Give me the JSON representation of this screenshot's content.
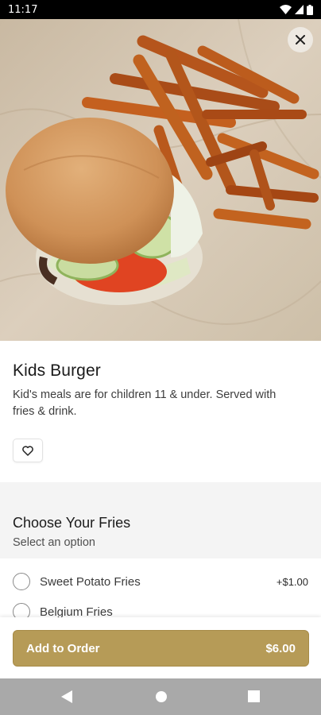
{
  "status_bar": {
    "time": "11:17",
    "icons": [
      "wifi-icon",
      "cell-signal-icon",
      "battery-icon"
    ]
  },
  "hero": {
    "image": "burger-with-sweet-potato-fries-photo",
    "close_icon": "close-icon"
  },
  "item": {
    "title": "Kids Burger",
    "description": "Kid's meals are for children 11 & under. Served with fries & drink.",
    "favorite_icon": "heart-outline-icon"
  },
  "option_group": {
    "title": "Choose Your Fries",
    "subtitle": "Select an option",
    "options": [
      {
        "label": "Sweet Potato Fries",
        "price": "+$1.00",
        "selected": false
      },
      {
        "label": "Belgium Fries",
        "price": "",
        "selected": false
      }
    ]
  },
  "footer": {
    "add_label": "Add to Order",
    "total": "$6.00"
  },
  "nav_bar": {
    "icons": [
      "back-triangle-icon",
      "home-circle-icon",
      "recents-square-icon"
    ]
  },
  "colors": {
    "accent": "#b69b57",
    "section_bg": "#f4f4f4",
    "nav_bg": "#a9a9a9"
  }
}
